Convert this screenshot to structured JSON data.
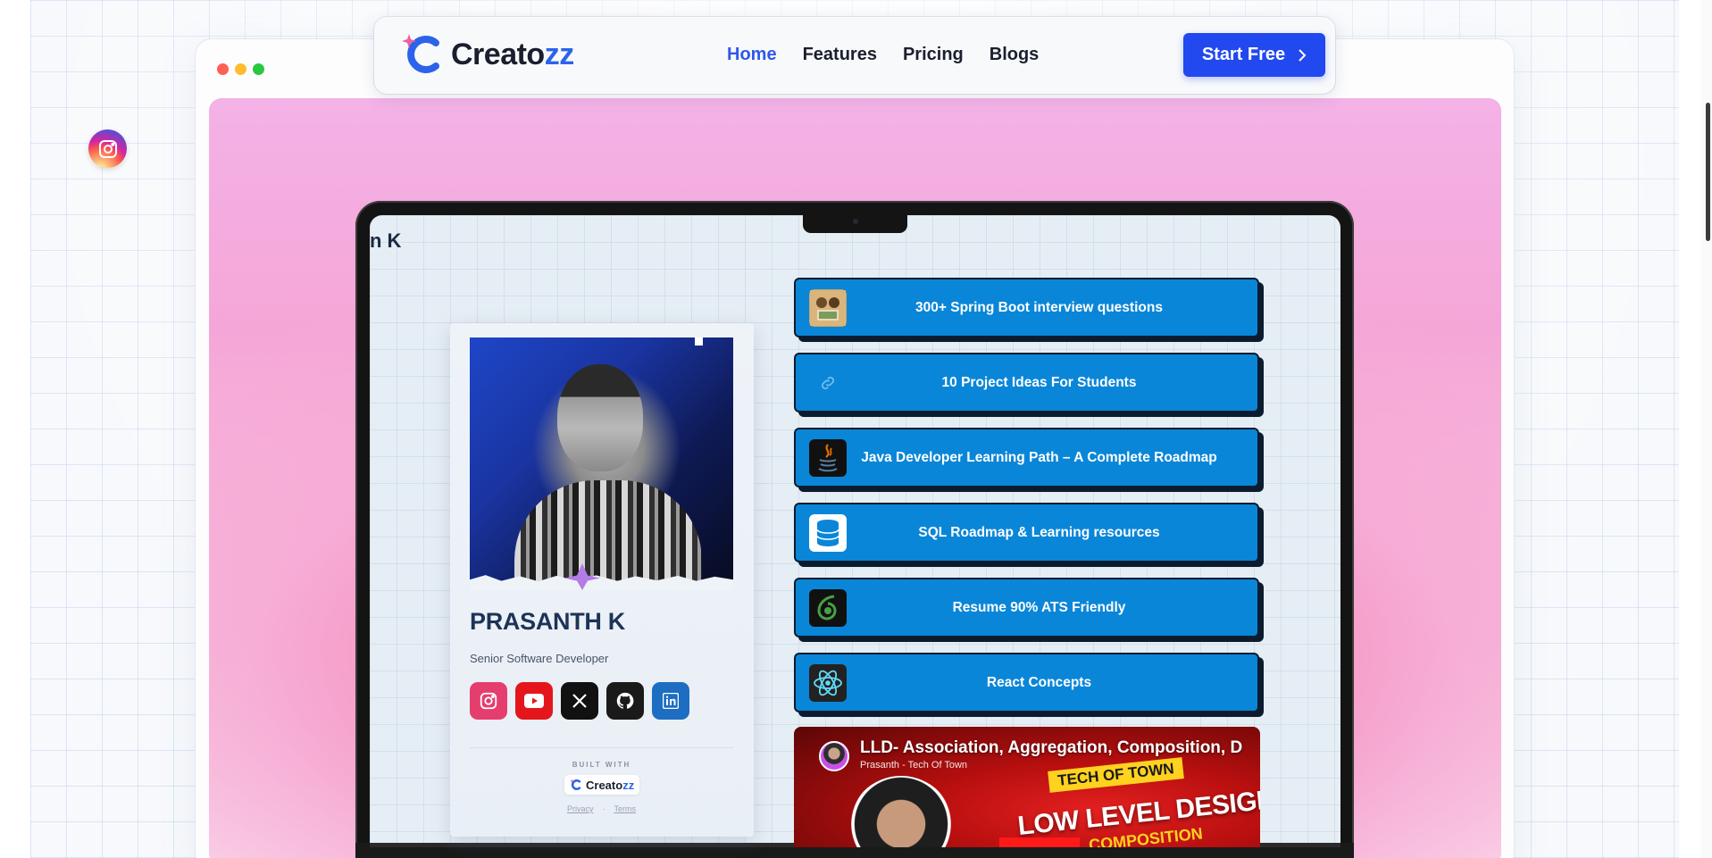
{
  "brand": {
    "name_main": "Creato",
    "name_accent": "zz",
    "accent_color": "#2b63ea"
  },
  "nav": {
    "links": [
      "Home",
      "Features",
      "Pricing",
      "Blogs"
    ],
    "active": "Home",
    "cta_label": "Start Free"
  },
  "floating_social": {
    "icon": "instagram-icon"
  },
  "profile_page": {
    "header_fragment": "n K",
    "name": "PRASANTH K",
    "title": "Senior Software Developer",
    "socials": [
      "instagram-icon",
      "youtube-icon",
      "x-icon",
      "github-icon",
      "linkedin-icon"
    ],
    "built_with_label": "BUILT WITH",
    "built_with_brand_main": "Creato",
    "built_with_brand_accent": "zz",
    "legal": {
      "privacy": "Privacy",
      "separator": "·",
      "terms": "Terms"
    }
  },
  "links": [
    {
      "label": "300+ Spring Boot interview questions",
      "icon": "thumbnail-icon"
    },
    {
      "label": "10 Project Ideas For Students",
      "icon": "link-icon"
    },
    {
      "label": "Java Developer Learning Path – A Complete Roadmap",
      "icon": "java-icon"
    },
    {
      "label": "SQL Roadmap & Learning resources",
      "icon": "database-icon"
    },
    {
      "label": "Resume 90% ATS Friendly",
      "icon": "overleaf-icon"
    },
    {
      "label": "React Concepts",
      "icon": "react-icon"
    }
  ],
  "video": {
    "title": "LLD- Association, Aggregation, Composition, D",
    "channel": "Prasanth - Tech Of Town",
    "tag": "TECH OF TOWN",
    "big_text": "LOW LEVEL DESIGN",
    "sub_text": "COMPOSITION"
  },
  "colors": {
    "button_blue": "#0a86d8",
    "cta_blue": "#2248ef",
    "nav_active": "#2f58e9"
  }
}
